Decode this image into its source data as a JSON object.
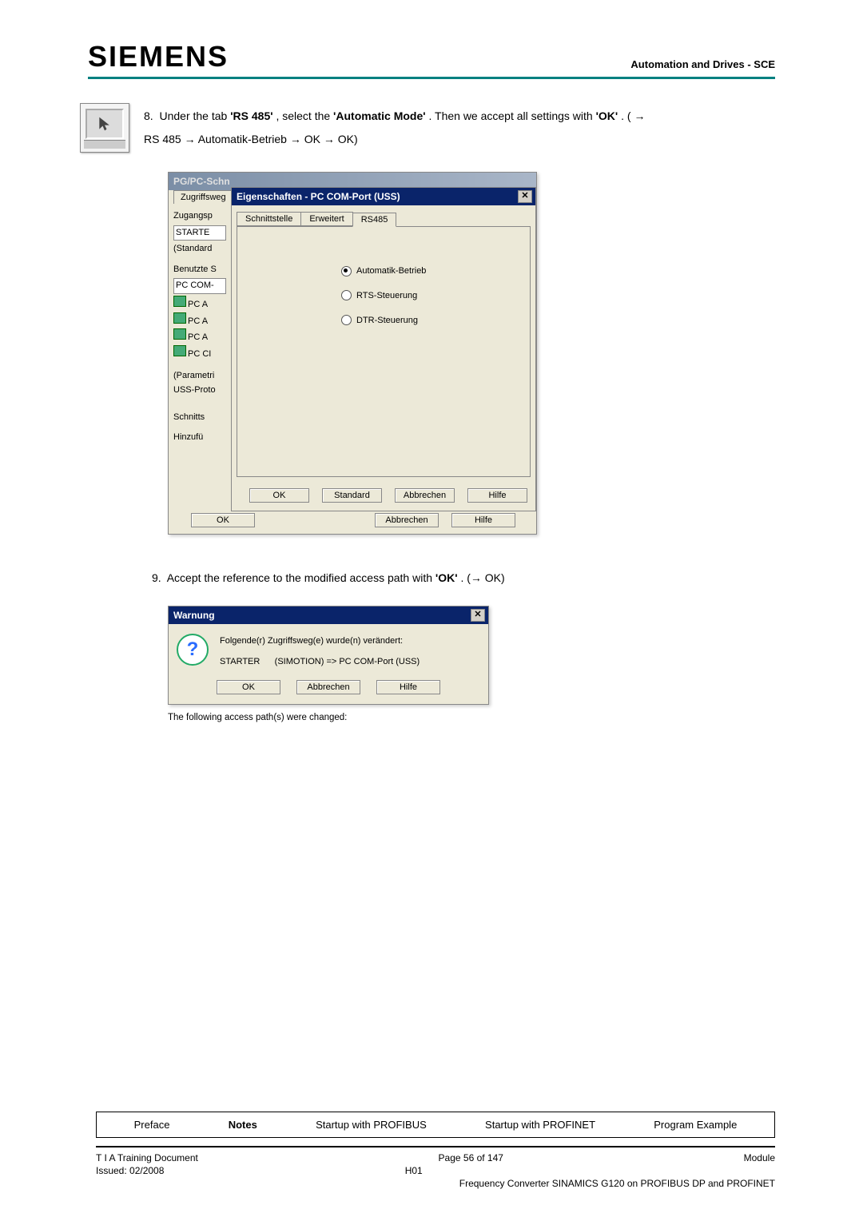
{
  "header": {
    "logo": "SIEMENS",
    "right": "Automation and Drives - SCE"
  },
  "step8": {
    "num": "8.",
    "t1": "Under the tab ",
    "b1": "'RS 485'",
    "t2": ", select the ",
    "b2": "'Automatic Mode'",
    "t3": ". Then we accept all settings with ",
    "b3": "'OK'",
    "t4": ". ( →",
    "line2": "RS 485 → Automatik-Betrieb → OK → OK)"
  },
  "dlg1": {
    "title_prefix": "PG/PC-Schn",
    "tab": "Zugriffsweg",
    "left_items": {
      "zugangsp": "Zugangsp",
      "starte": "STARTE",
      "standard": "(Standard",
      "benutzte": "Benutzte S",
      "pccom": "PC COM-",
      "pca1": "PC A",
      "pca2": "PC A",
      "pca3": "PC A",
      "pcc": "PC CI",
      "parametri": "(Parametri",
      "ussproto": "USS-Proto",
      "schnitts": "Schnitts",
      "hinzufu": "Hinzufü"
    },
    "ok": "OK",
    "abbrechen": "Abbrechen",
    "hilfe": "Hilfe"
  },
  "dlg2": {
    "title": "Eigenschaften - PC COM-Port (USS)",
    "close": "✕",
    "tabs": [
      "Schnittstelle",
      "Erweitert",
      "RS485"
    ],
    "radios": {
      "auto": "Automatik-Betrieb",
      "rts": "RTS-Steuerung",
      "dtr": "DTR-Steuerung"
    },
    "btns": {
      "ok": "OK",
      "standard": "Standard",
      "abbrechen": "Abbrechen",
      "hilfe": "Hilfe"
    }
  },
  "step9": {
    "num": "9.",
    "t1": "Accept the reference to the modified access path with ",
    "b1": "'OK'",
    "t2": ". (→ OK)"
  },
  "dlg3": {
    "title": "Warnung",
    "close": "✕",
    "line1": "Folgende(r) Zugriffsweg(e) wurde(n) verändert:",
    "line2_a": "STARTER",
    "line2_b": "(SIMOTION) => PC COM-Port (USS)",
    "btns": {
      "ok": "OK",
      "abbrechen": "Abbrechen",
      "hilfe": "Hilfe"
    }
  },
  "caption": "The following access path(s) were changed:",
  "footer": {
    "tabs": [
      "Preface",
      "Notes",
      "Startup with PROFIBUS",
      "Startup with PROFINET",
      "Program Example"
    ],
    "active_idx": 1,
    "left1": "T I A  Training Document",
    "center1": "Page 56 of 147",
    "right1": "Module",
    "left2": "Issued: 02/2008",
    "center2": "H01",
    "right2": "Frequency Converter SINAMICS G120 on PROFIBUS DP and PROFINET"
  }
}
